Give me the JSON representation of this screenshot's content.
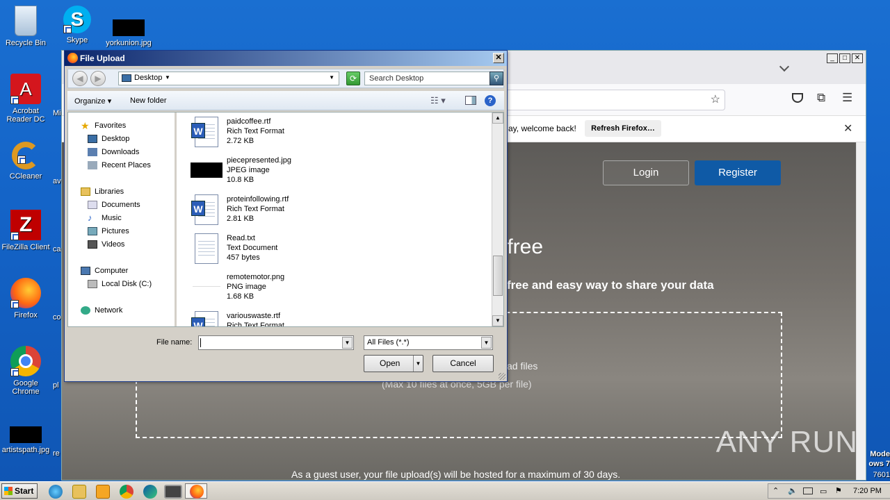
{
  "desktop": {
    "icons": [
      {
        "label": "Recycle Bin",
        "icon": "recycle-bin-icon"
      },
      {
        "label": "Skype",
        "icon": "skype-icon"
      },
      {
        "label": "yorkunion.jpg",
        "icon": "image-file-icon"
      },
      {
        "label": "Acrobat Reader DC",
        "icon": "acrobat-icon"
      },
      {
        "label": "CCleaner",
        "icon": "ccleaner-icon"
      },
      {
        "label": "FileZilla Client",
        "icon": "filezilla-icon"
      },
      {
        "label": "Firefox",
        "icon": "firefox-icon"
      },
      {
        "label": "Google Chrome",
        "icon": "chrome-icon"
      },
      {
        "label": "artistspath.jpg",
        "icon": "image-file-icon"
      }
    ],
    "cut_labels": [
      "Mi",
      "av",
      "ca",
      "co",
      "pl",
      "re"
    ]
  },
  "firefox_page": {
    "notification_text": "ay, welcome back!",
    "refresh_button": "Refresh Firefox…",
    "login": "Login",
    "register": "Register",
    "headline_fragment": "r free",
    "subheadline": "free and easy way to share your data",
    "upload_hint": "ad files",
    "upload_limit": "(Max 10 files at once, 5GB per file)",
    "guest_notice": "As a guest user, your file upload(s) will be hosted for a maximum of 30 days."
  },
  "dialog": {
    "title": "File Upload",
    "close": "✕",
    "location": "Desktop",
    "search_placeholder": "Search Desktop",
    "organize": "Organize",
    "new_folder": "New folder",
    "nav": {
      "favorites": "Favorites",
      "desktop": "Desktop",
      "downloads": "Downloads",
      "recent": "Recent Places",
      "libraries": "Libraries",
      "documents": "Documents",
      "music": "Music",
      "pictures": "Pictures",
      "videos": "Videos",
      "computer": "Computer",
      "local_disk": "Local Disk (C:)",
      "network": "Network"
    },
    "files": [
      {
        "name": "paidcoffee.rtf",
        "type": "Rich Text Format",
        "size": "2.72 KB"
      },
      {
        "name": "piecepresented.jpg",
        "type": "JPEG image",
        "size": "10.8 KB"
      },
      {
        "name": "proteinfollowing.rtf",
        "type": "Rich Text Format",
        "size": "2.81 KB"
      },
      {
        "name": "Read.txt",
        "type": "Text Document",
        "size": "457 bytes"
      },
      {
        "name": "remotemotor.png",
        "type": "PNG image",
        "size": "1.68 KB"
      },
      {
        "name": "variouswaste.rtf",
        "type": "Rich Text Format",
        "size": ""
      }
    ],
    "file_name_label": "File name:",
    "file_name_value": "",
    "filter": "All Files (*.*)",
    "open": "Open",
    "cancel": "Cancel"
  },
  "taskbar": {
    "start": "Start",
    "clock": "7:20 PM"
  },
  "overlay": {
    "watermark": "ANY RUN",
    "mode_line1": "Mode",
    "mode_line2": "ows 7",
    "mode_line3": "7601"
  }
}
